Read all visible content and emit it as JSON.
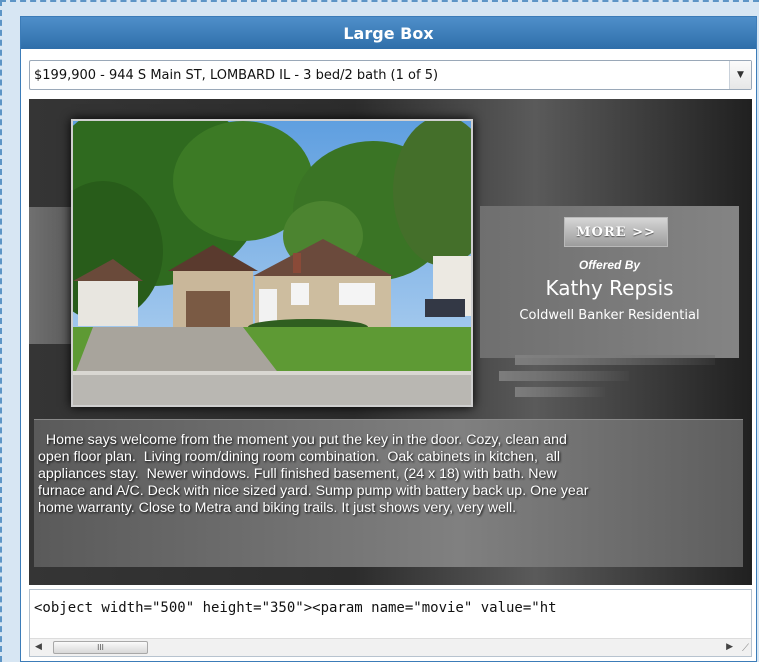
{
  "window": {
    "title": "Large Box"
  },
  "listing_select": {
    "selected": "$199,900 - 944 S Main ST, LOMBARD IL - 3 bed/2 bath (1 of 5)"
  },
  "listing": {
    "more_label": "MORE >>",
    "offered_by": "Offered By",
    "agent_name": "Kathy Repsis",
    "company": "Coldwell Banker Residential",
    "description": "  Home says welcome from the moment you put the key in the door. Cozy, clean and\nopen floor plan.  Living room/dining room combination.  Oak cabinets in kitchen,  all\nappliances stay.  Newer windows. Full finished basement, (24 x 18) with bath. New\nfurnace and A/C. Deck with nice sized yard. Sump pump with battery back up. One year\nhome warranty. Close to Metra and biking trails. It just shows very, very well."
  },
  "embed_code": {
    "value": "<object width=\"500\" height=\"350\"><param name=\"movie\" value=\"ht"
  },
  "icons": [
    "chevron-down-icon",
    "scroll-left-icon",
    "scroll-right-icon",
    "resize-grip-icon",
    "house-photo"
  ],
  "colors": {
    "title_bar": "#3b7cb8",
    "listing_bg": "#2e2e2e",
    "dashed_border": "#5d95c6"
  }
}
